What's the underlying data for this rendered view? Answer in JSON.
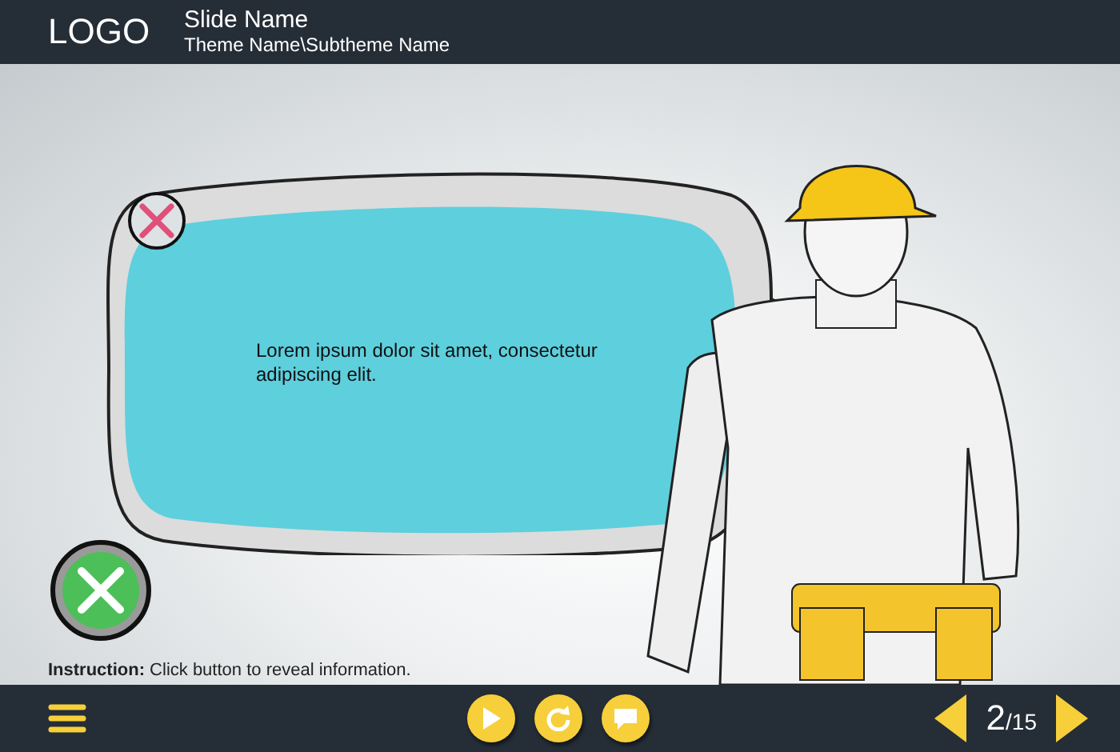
{
  "header": {
    "logo": "LOGO",
    "slide_name": "Slide Name",
    "theme_path": "Theme Name\\Subtheme Name"
  },
  "callout": {
    "text": "Lorem ipsum dolor sit amet, consectetur adipiscing elit."
  },
  "instruction": "**Instruction:** Click button to reveal information.",
  "footer": {
    "page_current": "2",
    "page_total": "/15"
  }
}
